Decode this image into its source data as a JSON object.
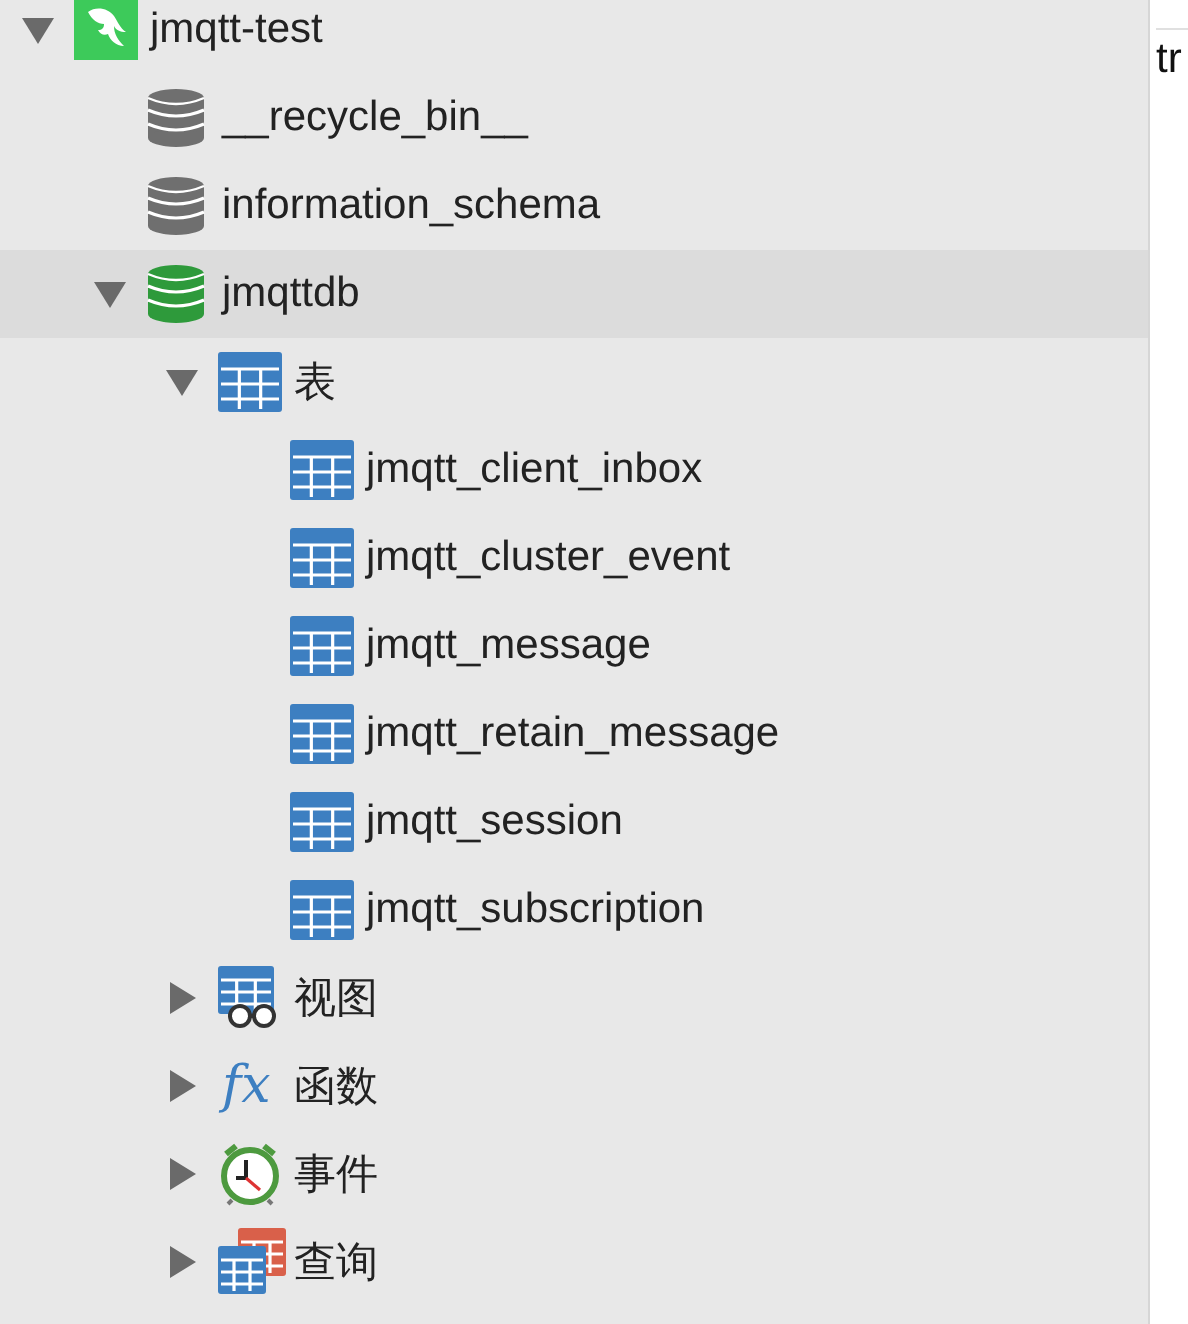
{
  "tree": [
    {
      "kind": "server",
      "label": "jmqtt-test",
      "expanded": true,
      "selected": false,
      "children": [
        {
          "kind": "database",
          "label": "__recycle_bin__",
          "active": false,
          "selected": false
        },
        {
          "kind": "database",
          "label": "information_schema",
          "active": false,
          "selected": false
        },
        {
          "kind": "database",
          "label": "jmqttdb",
          "active": true,
          "expanded": true,
          "selected": true,
          "children": [
            {
              "kind": "tables",
              "label": "表",
              "expanded": true,
              "selected": false,
              "children": [
                {
                  "kind": "table",
                  "label": "jmqtt_client_inbox",
                  "selected": false
                },
                {
                  "kind": "table",
                  "label": "jmqtt_cluster_event",
                  "selected": false
                },
                {
                  "kind": "table",
                  "label": "jmqtt_message",
                  "selected": false
                },
                {
                  "kind": "table",
                  "label": "jmqtt_retain_message",
                  "selected": false
                },
                {
                  "kind": "table",
                  "label": "jmqtt_session",
                  "selected": false
                },
                {
                  "kind": "table",
                  "label": "jmqtt_subscription",
                  "selected": false
                }
              ]
            },
            {
              "kind": "views",
              "label": "视图",
              "expanded": false,
              "selected": false
            },
            {
              "kind": "functions",
              "label": "函数",
              "icon_text": "fx",
              "expanded": false,
              "selected": false
            },
            {
              "kind": "events",
              "label": "事件",
              "expanded": false,
              "selected": false
            },
            {
              "kind": "queries",
              "label": "查询",
              "expanded": false,
              "selected": false
            }
          ]
        }
      ]
    }
  ],
  "editor": {
    "text": "tr"
  }
}
